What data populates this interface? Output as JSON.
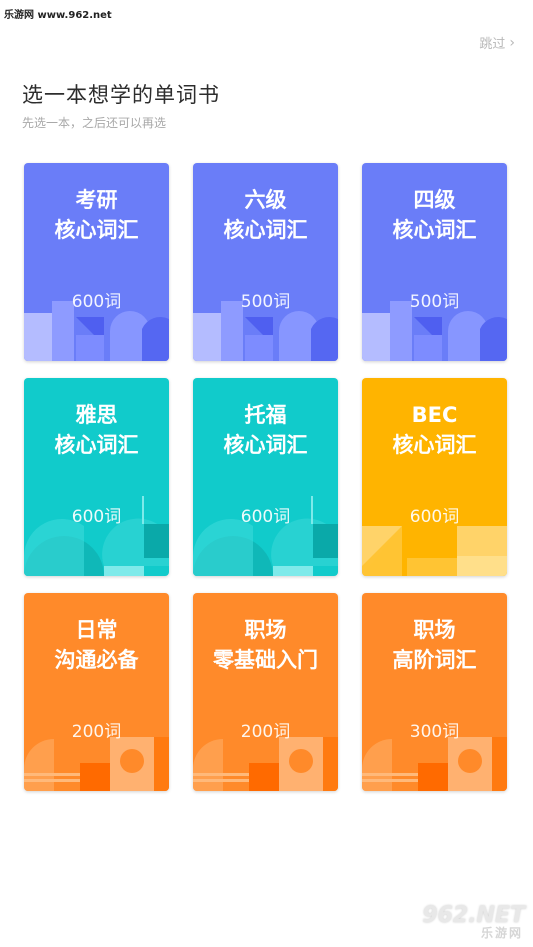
{
  "watermark_top": "乐游网 www.962.net",
  "skip_label": "跳过",
  "title": "选一本想学的单词书",
  "subtitle": "先选一本，之后还可以再选",
  "books": [
    {
      "line1": "考研",
      "line2": "核心词汇",
      "count": "600词",
      "color": "#6a7df8",
      "theme": "blue"
    },
    {
      "line1": "六级",
      "line2": "核心词汇",
      "count": "500词",
      "color": "#6a7df8",
      "theme": "blue"
    },
    {
      "line1": "四级",
      "line2": "核心词汇",
      "count": "500词",
      "color": "#6a7df8",
      "theme": "blue"
    },
    {
      "line1": "雅思",
      "line2": "核心词汇",
      "count": "600词",
      "color": "#11cbcb",
      "theme": "teal"
    },
    {
      "line1": "托福",
      "line2": "核心词汇",
      "count": "600词",
      "color": "#11cbcb",
      "theme": "teal"
    },
    {
      "line1": "BEC",
      "line2": "核心词汇",
      "count": "600词",
      "color": "#ffb400",
      "theme": "yellow"
    },
    {
      "line1": "日常",
      "line2": "沟通必备",
      "count": "200词",
      "color": "#ff8a2a",
      "theme": "orange"
    },
    {
      "line1": "职场",
      "line2": "零基础入门",
      "count": "200词",
      "color": "#ff8a2a",
      "theme": "orange"
    },
    {
      "line1": "职场",
      "line2": "高阶词汇",
      "count": "300词",
      "color": "#ff8a2a",
      "theme": "orange"
    }
  ],
  "watermark_bottom": {
    "logo": "962.NET",
    "sub": "乐游网"
  }
}
